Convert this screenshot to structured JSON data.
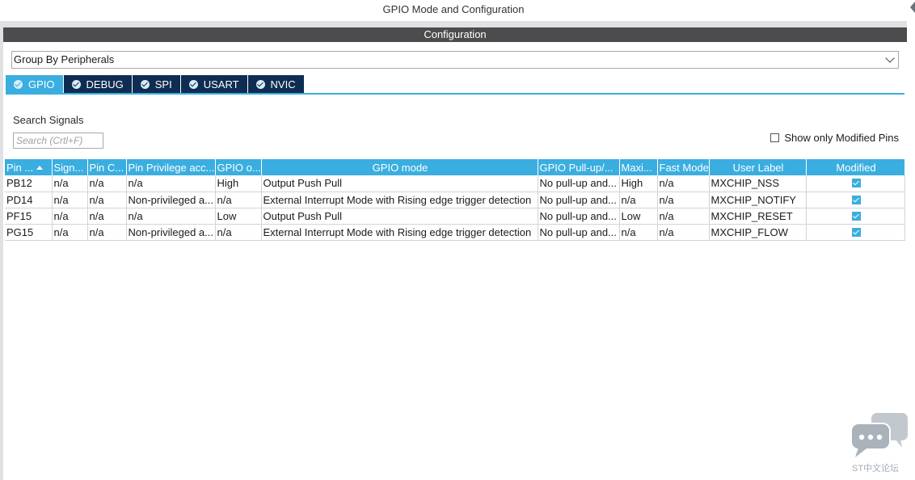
{
  "window": {
    "title": "GPIO Mode and Configuration"
  },
  "panel": {
    "header": "Configuration"
  },
  "group_select": {
    "value": "Group By Peripherals"
  },
  "tabs": [
    {
      "label": "GPIO",
      "active": true
    },
    {
      "label": "DEBUG",
      "active": false
    },
    {
      "label": "SPI",
      "active": false
    },
    {
      "label": "USART",
      "active": false
    },
    {
      "label": "NVIC",
      "active": false
    }
  ],
  "search": {
    "label": "Search Signals",
    "placeholder": "Search (Crtl+F)"
  },
  "show_modified": {
    "label": "Show only Modified Pins",
    "checked": false
  },
  "table": {
    "columns": [
      "Pin ...",
      "Sign...",
      "Pin C...",
      "Pin Privilege acc...",
      "GPIO o...",
      "GPIO mode",
      "GPIO Pull-up/...",
      "Maxi...",
      "Fast Mode",
      "User Label",
      "Modified"
    ],
    "rows": [
      [
        "PB12",
        "n/a",
        "n/a",
        "n/a",
        "High",
        "Output Push Pull",
        "No pull-up and...",
        "High",
        "n/a",
        "MXCHIP_NSS"
      ],
      [
        "PD14",
        "n/a",
        "n/a",
        "Non-privileged a...",
        "n/a",
        "External Interrupt Mode with Rising edge trigger detection",
        "No pull-up and...",
        "n/a",
        "n/a",
        "MXCHIP_NOTIFY"
      ],
      [
        "PF15",
        "n/a",
        "n/a",
        "n/a",
        "Low",
        "Output Push Pull",
        "No pull-up and...",
        "Low",
        "n/a",
        "MXCHIP_RESET"
      ],
      [
        "PG15",
        "n/a",
        "n/a",
        "Non-privileged a...",
        "n/a",
        "External Interrupt Mode with Rising edge trigger detection",
        "No pull-up and...",
        "n/a",
        "n/a",
        "MXCHIP_FLOW"
      ]
    ],
    "modified": [
      true,
      true,
      true,
      true
    ]
  },
  "watermark": {
    "label": "ST中文论坛",
    "icon": "chat-bubbles-icon"
  },
  "colors": {
    "accent": "#3aaee0",
    "tab_dark": "#0f2d52",
    "header_bar": "#4c4c4e"
  }
}
